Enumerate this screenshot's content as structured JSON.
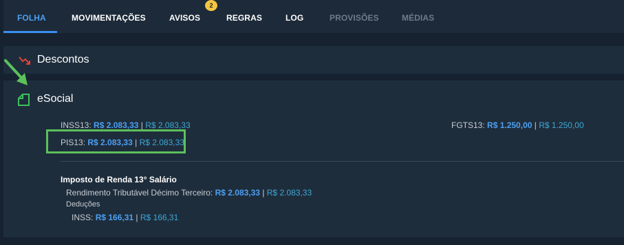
{
  "tabs": [
    {
      "label": "FOLHA",
      "state": "active"
    },
    {
      "label": "MOVIMENTAÇÕES",
      "state": "normal"
    },
    {
      "label": "AVISOS",
      "state": "normal",
      "badge": "2"
    },
    {
      "label": "REGRAS",
      "state": "normal"
    },
    {
      "label": "LOG",
      "state": "normal"
    },
    {
      "label": "PROVISÕES",
      "state": "muted"
    },
    {
      "label": "MÉDIAS",
      "state": "muted"
    }
  ],
  "descontos": {
    "title": "Descontos"
  },
  "esocial": {
    "title": "eSocial",
    "inss13": {
      "label": "INSS13:",
      "value": "R$ 2.083,33",
      "sep": "|",
      "alt": "R$ 2.083,33"
    },
    "fgts13": {
      "label": "FGTS13:",
      "value": "R$ 1.250,00",
      "sep": "|",
      "alt": "R$ 1.250,00"
    },
    "pis13": {
      "label": "PIS13:",
      "value": "R$ 2.083,33",
      "sep": "|",
      "alt": "R$ 2.083,33"
    },
    "ir": {
      "title": "Imposto de Renda 13° Salário",
      "rendimento": {
        "label": "Rendimento Tributável Décimo Terceiro:",
        "value": "R$ 2.083,33",
        "sep": "|",
        "alt": "R$ 2.083,33"
      },
      "deducoes": "Deduções",
      "inss": {
        "label": "INSS:",
        "value": "R$ 166,31",
        "sep": "|",
        "alt": "R$ 166,31"
      }
    }
  },
  "colors": {
    "accent": "#4d9ff2",
    "highlight": "#5cc15b",
    "badge": "#f5c542",
    "trend_down": "#e0443c"
  }
}
